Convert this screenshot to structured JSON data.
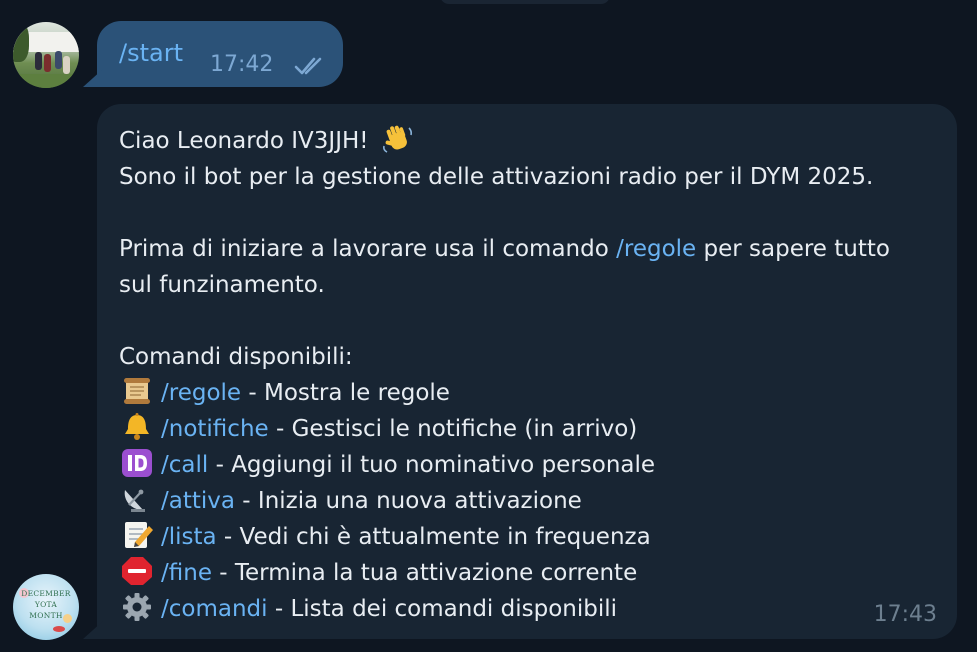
{
  "outgoing": {
    "text": "/start",
    "time": "17:42",
    "status": "read"
  },
  "incoming": {
    "greeting": "Ciao Leonardo IV3JJH!",
    "greeting_emoji": "waving-hand-icon",
    "intro": "Sono il bot per la gestione delle attivazioni radio per il DYM 2025.",
    "rules_prefix": "Prima di iniziare a lavorare usa il comando",
    "rules_command": "/regole",
    "rules_suffix": "per sapere tutto",
    "rules_line2": "sul funzinamento.",
    "commands_title": "Comandi disponibili:",
    "commands": [
      {
        "icon": "scroll-icon",
        "command": "/regole",
        "description": " - Mostra le regole"
      },
      {
        "icon": "bell-icon",
        "command": "/notifiche",
        "description": " - Gestisci le notifiche (in arrivo)"
      },
      {
        "icon": "id-icon",
        "command": "/call",
        "description": " - Aggiungi il tuo nominativo personale"
      },
      {
        "icon": "satellite-dish-icon",
        "command": "/attiva",
        "description": " - Inizia una nuova attivazione"
      },
      {
        "icon": "memo-icon",
        "command": "/lista",
        "description": " - Vedi chi è attualmente in frequenza"
      },
      {
        "icon": "stop-sign-icon",
        "command": "/fine",
        "description": " - Termina la tua attivazione corrente"
      },
      {
        "icon": "gear-icon",
        "command": "/comandi",
        "description": " - Lista dei comandi disponibili"
      }
    ],
    "time": "17:43"
  },
  "bot_avatar_text": [
    "DECEMBER",
    "YOTA",
    "MONTH"
  ],
  "colors": {
    "background": "#0e1621",
    "outgoing_bubble": "#2b5278",
    "incoming_bubble": "#182533",
    "link": "#6ab3f3",
    "text": "#e8edf2",
    "time_in": "#6d7f8f"
  }
}
